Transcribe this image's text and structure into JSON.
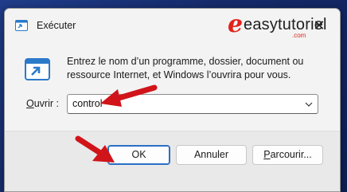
{
  "window": {
    "title": "Exécuter",
    "close_glyph": "✕",
    "title_icon": "run-app-icon"
  },
  "watermark": {
    "letter": "e",
    "name": "easytutoriel",
    "suffix": ".com"
  },
  "main": {
    "icon": "run-dialog-icon",
    "description": "Entrez le nom d’un programme, dossier, document ou ressource Internet, et Windows l’ouvrira pour vous.",
    "open_label_accel": "O",
    "open_label_rest": "uvrir :",
    "open_value": "control"
  },
  "buttons": {
    "ok": "OK",
    "cancel": "Annuler",
    "browse_accel": "P",
    "browse_rest": "arcourir..."
  },
  "colors": {
    "annotation_arrow": "#d0141a",
    "accent": "#2a6fc4",
    "desktop": "#1a3478"
  }
}
